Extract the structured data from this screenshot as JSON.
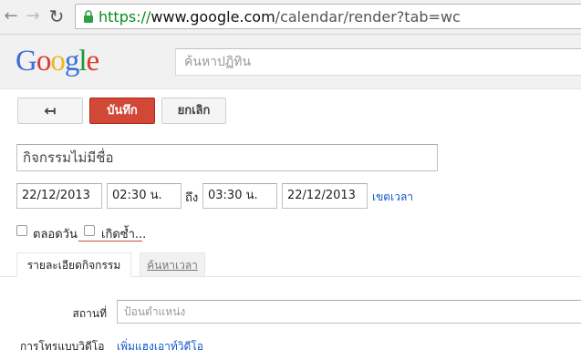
{
  "browser": {
    "url_scheme": "https://",
    "url_host": "www.google.com",
    "url_path": "/calendar/render?tab=wc"
  },
  "header": {
    "logo": [
      "G",
      "o",
      "o",
      "g",
      "l",
      "e"
    ],
    "search_placeholder": "ค้นหาปฏิทิน"
  },
  "toolbar": {
    "back_label": "↤",
    "save_label": "บันทึก",
    "cancel_label": "ยกเลิก"
  },
  "event": {
    "title_placeholder": "กิจกรรมไม่มีชื่อ",
    "start_date": "22/12/2013",
    "start_time": "02:30 น.",
    "to_label": "ถึง",
    "end_time": "03:30 น.",
    "end_date": "22/12/2013",
    "timezone_link": "เขตเวลา",
    "all_day_label": "ตลอดวัน",
    "repeat_label": "เกิดซ้ำ..."
  },
  "tabs": [
    {
      "label": "รายละเอียดกิจกรรม",
      "active": true
    },
    {
      "label": "ค้นหาเวลา",
      "active": false
    }
  ],
  "details": {
    "where_label": "สถานที่",
    "where_placeholder": "ป้อนตำแหน่ง",
    "video_label": "การโทรแบบวิดีโอ",
    "video_link": "เพิ่มแฮงเอาท์วิดีโอ"
  },
  "colors": {
    "save_button": "#d14836",
    "link": "#1155cc",
    "https": "#0a8c1a"
  }
}
